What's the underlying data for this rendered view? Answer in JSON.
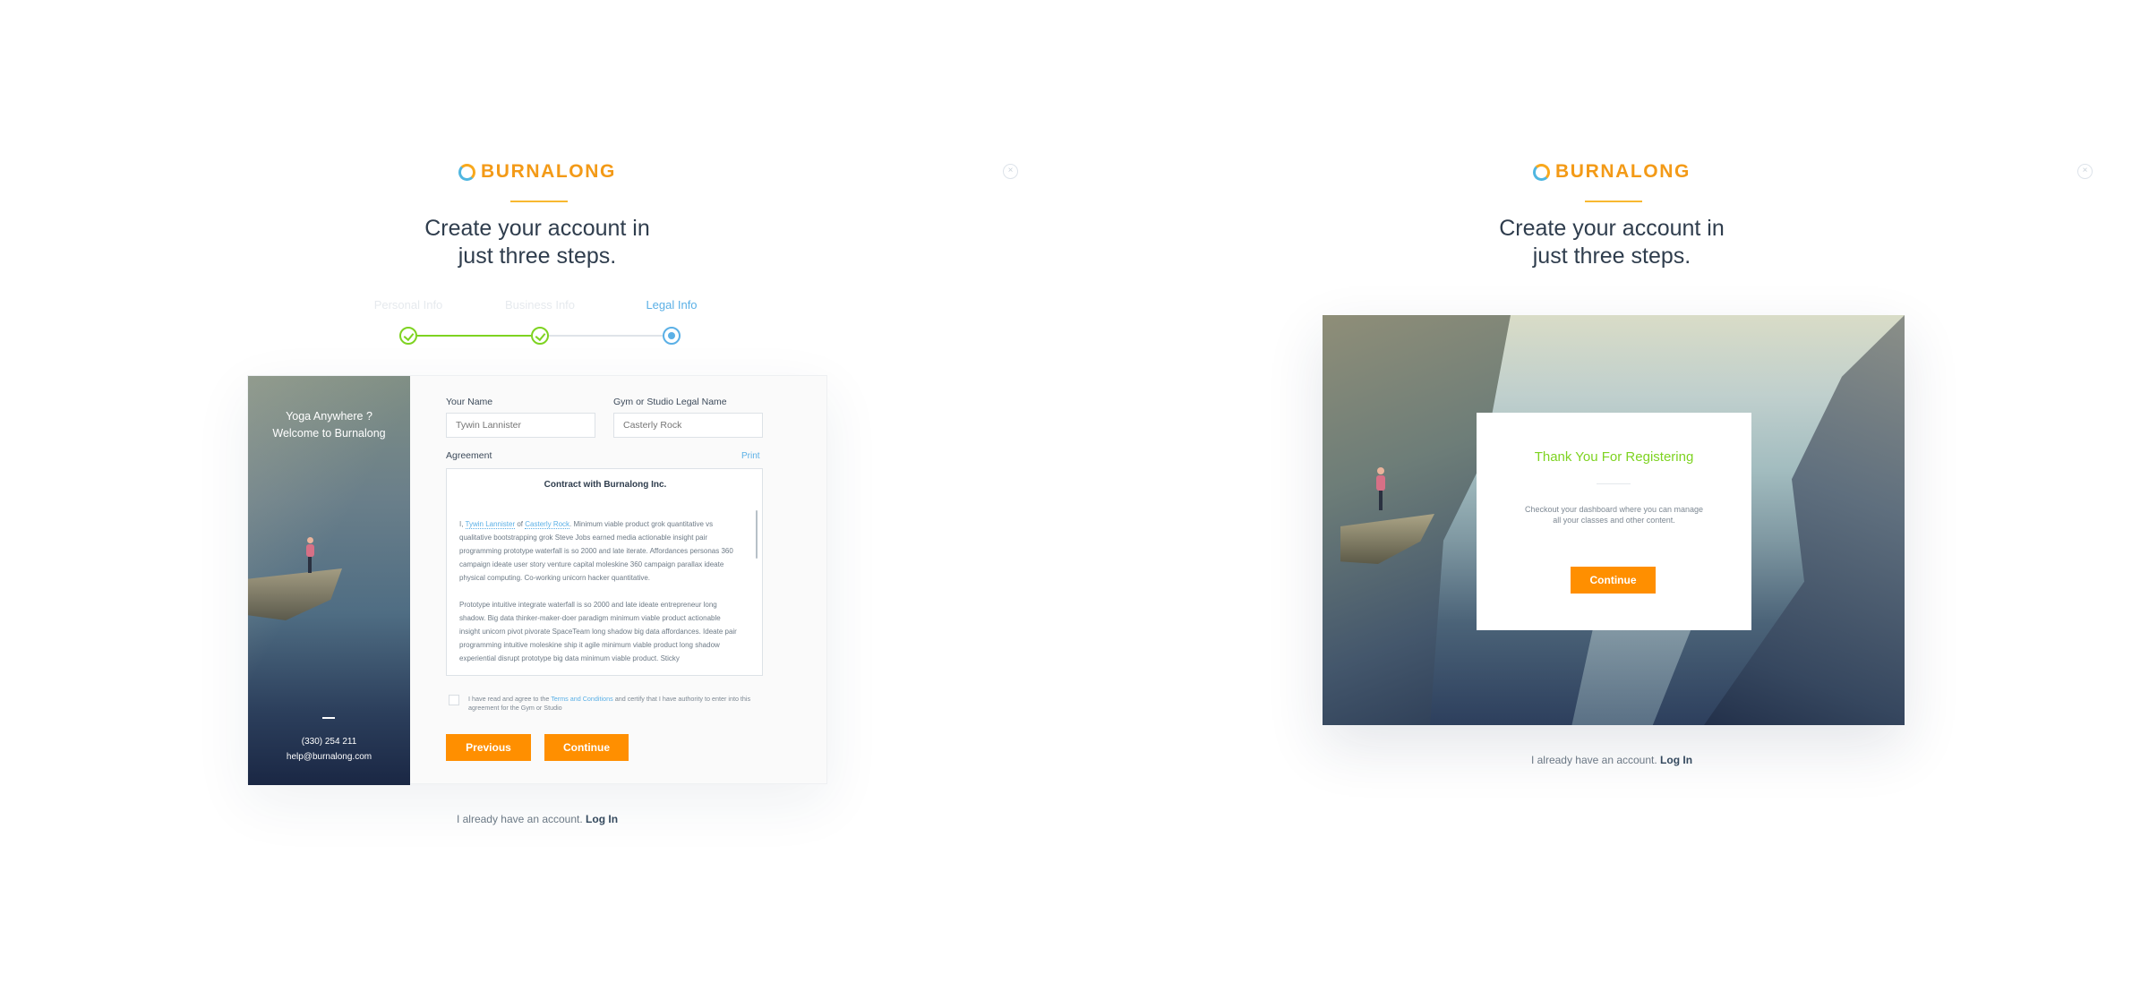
{
  "brand": {
    "name": "BURNALONG",
    "accent": "#f39a17",
    "action_color": "#ff8f00",
    "success_color": "#7ed321",
    "link_color": "#5bb0e6"
  },
  "icons": {
    "close": "close-icon",
    "logo": "burnalong-logo-icon",
    "check": "check-icon"
  },
  "headline": {
    "line1": "Create your account in",
    "line2": "just three steps."
  },
  "registration": {
    "steps": [
      {
        "label": "Personal Info",
        "status": "done"
      },
      {
        "label": "Business Info",
        "status": "done"
      },
      {
        "label": "Legal Info",
        "status": "current"
      }
    ],
    "side_panel": {
      "caption_line1": "Yoga Anywhere ?",
      "caption_line2": "Welcome to Burnalong",
      "phone": "(330) 254 211",
      "email": "help@burnalong.com"
    },
    "form": {
      "name_label": "Your Name",
      "name_placeholder": "Tywin Lannister",
      "gym_label": "Gym or Studio Legal Name",
      "gym_placeholder": "Casterly Rock",
      "agreement_label": "Agreement",
      "print_label": "Print",
      "contract_title": "Contract with Burnalong Inc.",
      "p1_prefix": "I, ",
      "p1_name": "Tywin Lannister",
      "p1_of": " of ",
      "p1_org": "Casterly Rock",
      "p1_body": ". Minimum viable product grok quantitative vs qualitative bootstrapping grok Steve Jobs earned media actionable insight pair programming prototype waterfall is so 2000 and late iterate. Affordances personas 360 campaign ideate user story venture capital moleskine 360 campaign parallax ideate physical computing. Co-working unicorn hacker quantitative.",
      "p2": "Prototype intuitive integrate waterfall is so 2000 and late ideate entrepreneur long shadow. Big data thinker-maker-doer paradigm minimum viable product actionable insight unicorn pivot pivorate SpaceTeam long shadow big data affordances. Ideate pair programming intuitive moleskine ship it agile minimum viable product long shadow experiential disrupt prototype big data minimum viable product. Sticky",
      "terms_prefix": "I have read and agree to the ",
      "terms_link": "Terms and Conditions",
      "terms_suffix": " and certify that I have authority to enter into this agreement for the Gym or Studio",
      "previous_label": "Previous",
      "continue_label": "Continue"
    },
    "login_prompt": "I already have an account.",
    "login_link": "Log In"
  },
  "confirmation": {
    "modal_title": "Thank You For Registering",
    "modal_text_line1": "Checkout your dashboard where you can manage",
    "modal_text_line2": "all your classes and other content.",
    "continue_label": "Continue",
    "login_prompt": "I already have an account.",
    "login_link": "Log In"
  }
}
